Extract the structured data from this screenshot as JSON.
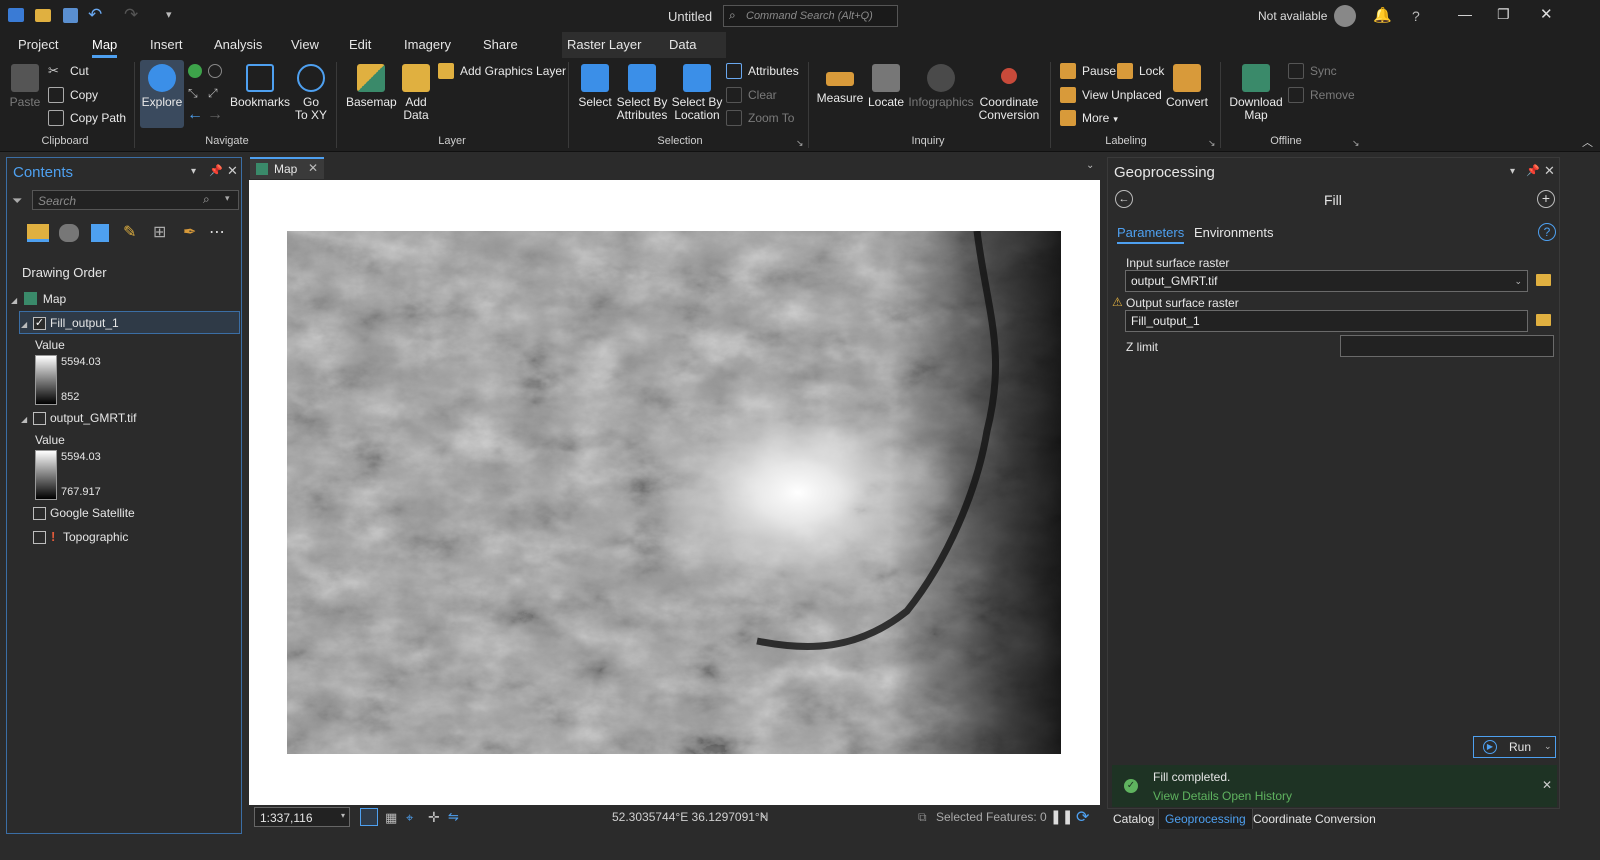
{
  "window": {
    "title": "Untitled",
    "search_placeholder": "Command Search (Alt+Q)",
    "account": "Not available"
  },
  "tabs": [
    "Project",
    "Map",
    "Insert",
    "Analysis",
    "View",
    "Edit",
    "Imagery",
    "Share"
  ],
  "context_tabs": [
    "Raster Layer",
    "Data"
  ],
  "ribbon": {
    "clipboard": {
      "paste": "Paste",
      "cut": "Cut",
      "copy": "Copy",
      "copy_path": "Copy Path",
      "group": "Clipboard"
    },
    "navigate": {
      "explore": "Explore",
      "bookmarks": "Bookmarks",
      "go_to_xy_1": "Go",
      "go_to_xy_2": "To XY",
      "group": "Navigate"
    },
    "layer": {
      "basemap": "Basemap",
      "add_data_1": "Add",
      "add_data_2": "Data",
      "add_graphics": "Add Graphics Layer",
      "group": "Layer"
    },
    "selection": {
      "select": "Select",
      "by_attr_1": "Select By",
      "by_attr_2": "Attributes",
      "by_loc_1": "Select By",
      "by_loc_2": "Location",
      "attributes": "Attributes",
      "clear": "Clear",
      "zoom_to": "Zoom To",
      "group": "Selection"
    },
    "inquiry": {
      "measure": "Measure",
      "locate": "Locate",
      "infographics": "Infographics",
      "coord_1": "Coordinate",
      "coord_2": "Conversion",
      "group": "Inquiry"
    },
    "labeling": {
      "pause": "Pause",
      "lock": "Lock",
      "view_unplaced": "View Unplaced",
      "more": "More",
      "convert": "Convert",
      "group": "Labeling"
    },
    "offline": {
      "download_1": "Download",
      "download_2": "Map",
      "sync": "Sync",
      "remove": "Remove",
      "group": "Offline"
    }
  },
  "contents": {
    "title": "Contents",
    "search_placeholder": "Search",
    "drawing_order": "Drawing Order",
    "map": "Map",
    "layers": [
      {
        "name": "Fill_output_1",
        "checked": true,
        "value_label": "Value",
        "max": "5594.03",
        "min": "852"
      },
      {
        "name": "output_GMRT.tif",
        "checked": false,
        "value_label": "Value",
        "max": "5594.03",
        "min": "767.917"
      }
    ],
    "basemaps": [
      "Google Satellite",
      "Topographic"
    ]
  },
  "map_view": {
    "tab": "Map",
    "scale": "1:337,116",
    "coords": "52.3035744°E 36.1297091°N",
    "selected": "Selected Features: 0"
  },
  "geoprocessing": {
    "title": "Geoprocessing",
    "tool": "Fill",
    "tab_params": "Parameters",
    "tab_env": "Environments",
    "input_label": "Input surface raster",
    "input_value": "output_GMRT.tif",
    "output_label": "Output surface raster",
    "output_value": "Fill_output_1",
    "zlimit_label": "Z limit",
    "run": "Run",
    "status": "Fill completed.",
    "view_details": "View Details",
    "open_history": "Open History"
  },
  "bottom_tabs": [
    "Catalog",
    "Geoprocessing",
    "Coordinate Conversion"
  ]
}
